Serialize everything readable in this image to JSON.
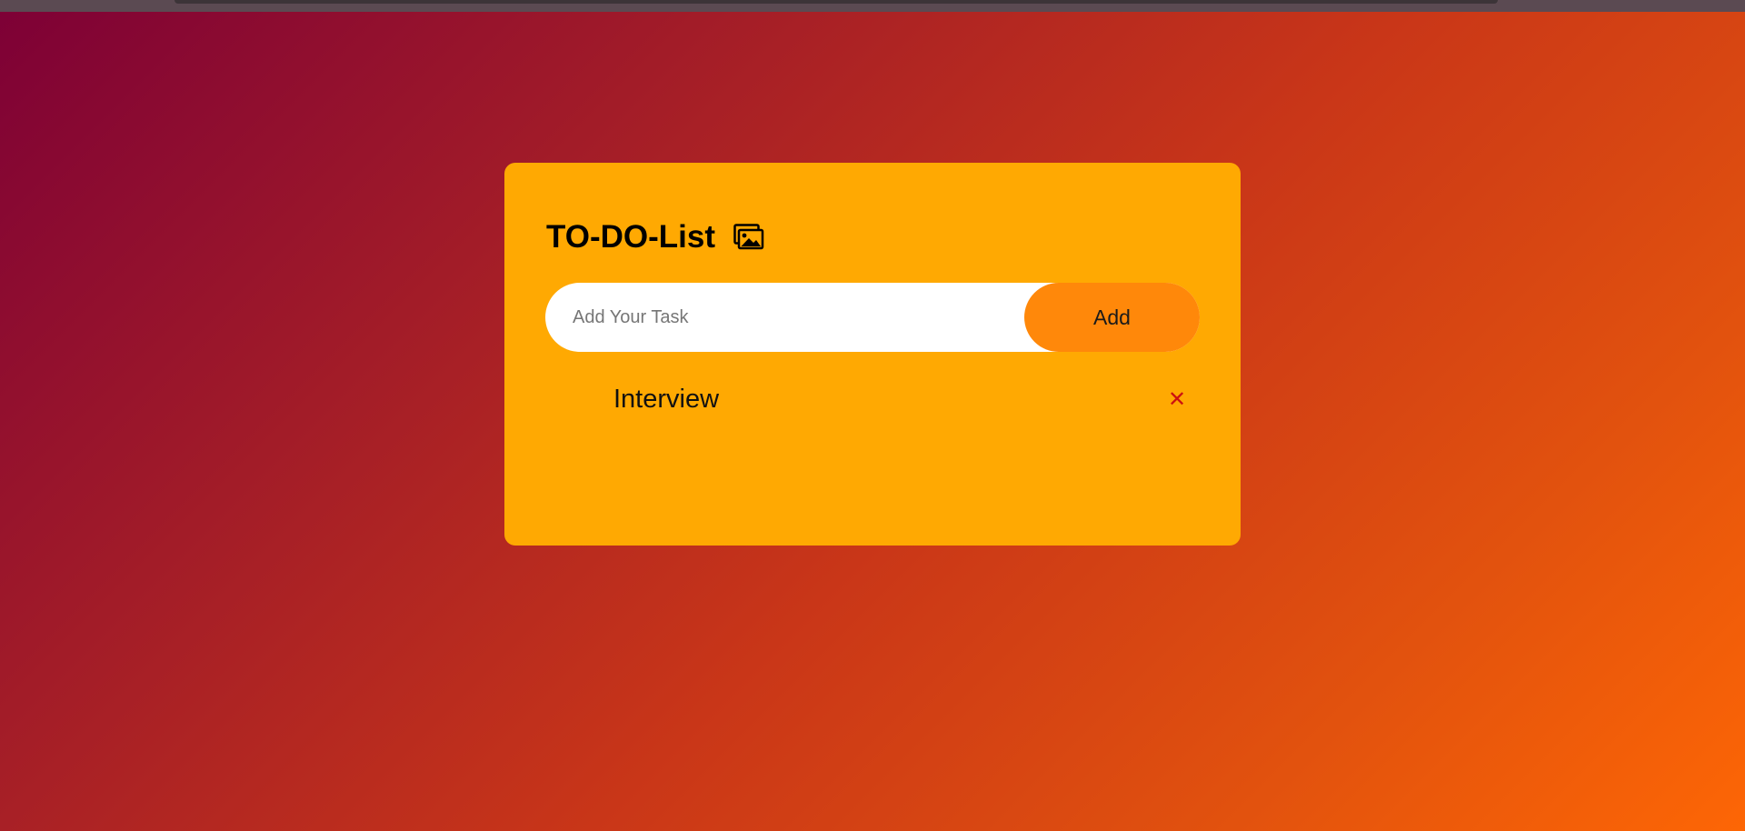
{
  "app": {
    "title": "TO-DO-List",
    "title_icon": "image-gallery-icon"
  },
  "input": {
    "placeholder": "Add Your Task",
    "value": ""
  },
  "add_button": {
    "label": "Add"
  },
  "tasks": [
    {
      "text": "Interview",
      "delete_glyph": "✕"
    }
  ],
  "colors": {
    "card": "#ffa902",
    "add_button": "#ff880a",
    "delete": "#cc1111",
    "gradient_start": "#7d0036",
    "gradient_end": "#fd6605"
  }
}
